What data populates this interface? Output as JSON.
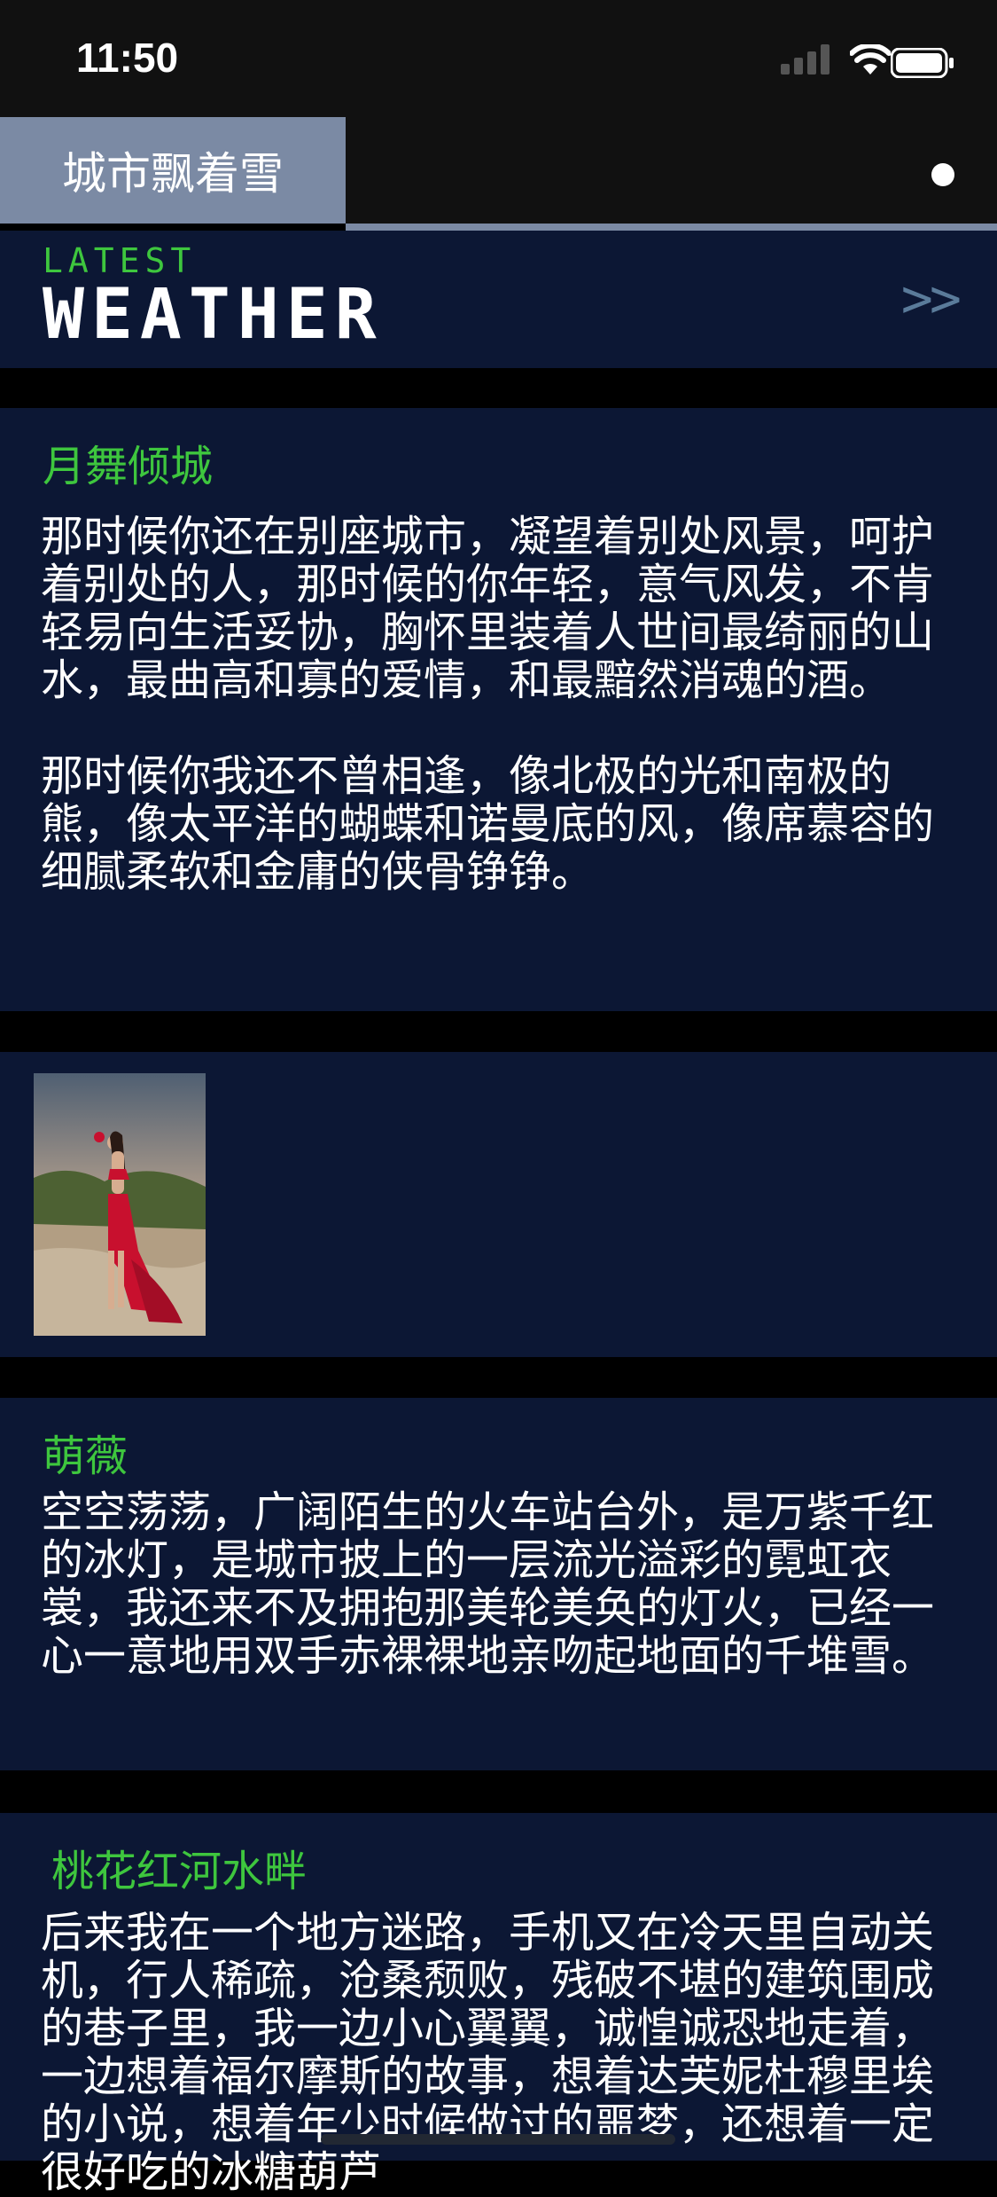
{
  "status_bar": {
    "time": "11:50"
  },
  "header": {
    "title": "城市飘着雪"
  },
  "banner": {
    "latest": "LATEST",
    "weather": "WEATHER",
    "more": ">>"
  },
  "posts": [
    {
      "author": "月舞倾城",
      "text": "那时候你还在别座城市，凝望着别处风景，呵护着别处的人，那时候的你年轻，意气风发，不肯轻易向生活妥协，胸怀里装着人世间最绮丽的山水，最曲高和寡的爱情，和最黯然消魂的酒。\n\n那时候你我还不曾相逢，像北极的光和南极的熊，像太平洋的蝴蝶和诺曼底的风，像席慕容的细腻柔软和金庸的侠骨铮铮。"
    },
    {
      "author": "萌薇",
      "text": "空空荡荡，广阔陌生的火车站台外，是万紫千红的冰灯，是城市披上的一层流光溢彩的霓虹衣裳，我还来不及拥抱那美轮美奂的灯火，已经一心一意地用双手赤裸裸地亲吻起地面的千堆雪。"
    },
    {
      "author": "桃花红河水畔",
      "text": "后来我在一个地方迷路，手机又在冷天里自动关机，行人稀疏，沧桑颓败，残破不堪的建筑围成的巷子里，我一边小心翼翼，诚惶诚恐地走着，一边想着福尔摩斯的故事，想着达芙妮杜穆里埃的小说，想着年少时候做过的噩梦，还想着一定很好吃的冰糖葫芦"
    }
  ],
  "photo": {
    "icon": "woman-in-red-dress-photo"
  },
  "colors": {
    "accent": "#3ec63e",
    "card_bg": "#0c1734",
    "tab_bg": "#7b8aa4"
  }
}
